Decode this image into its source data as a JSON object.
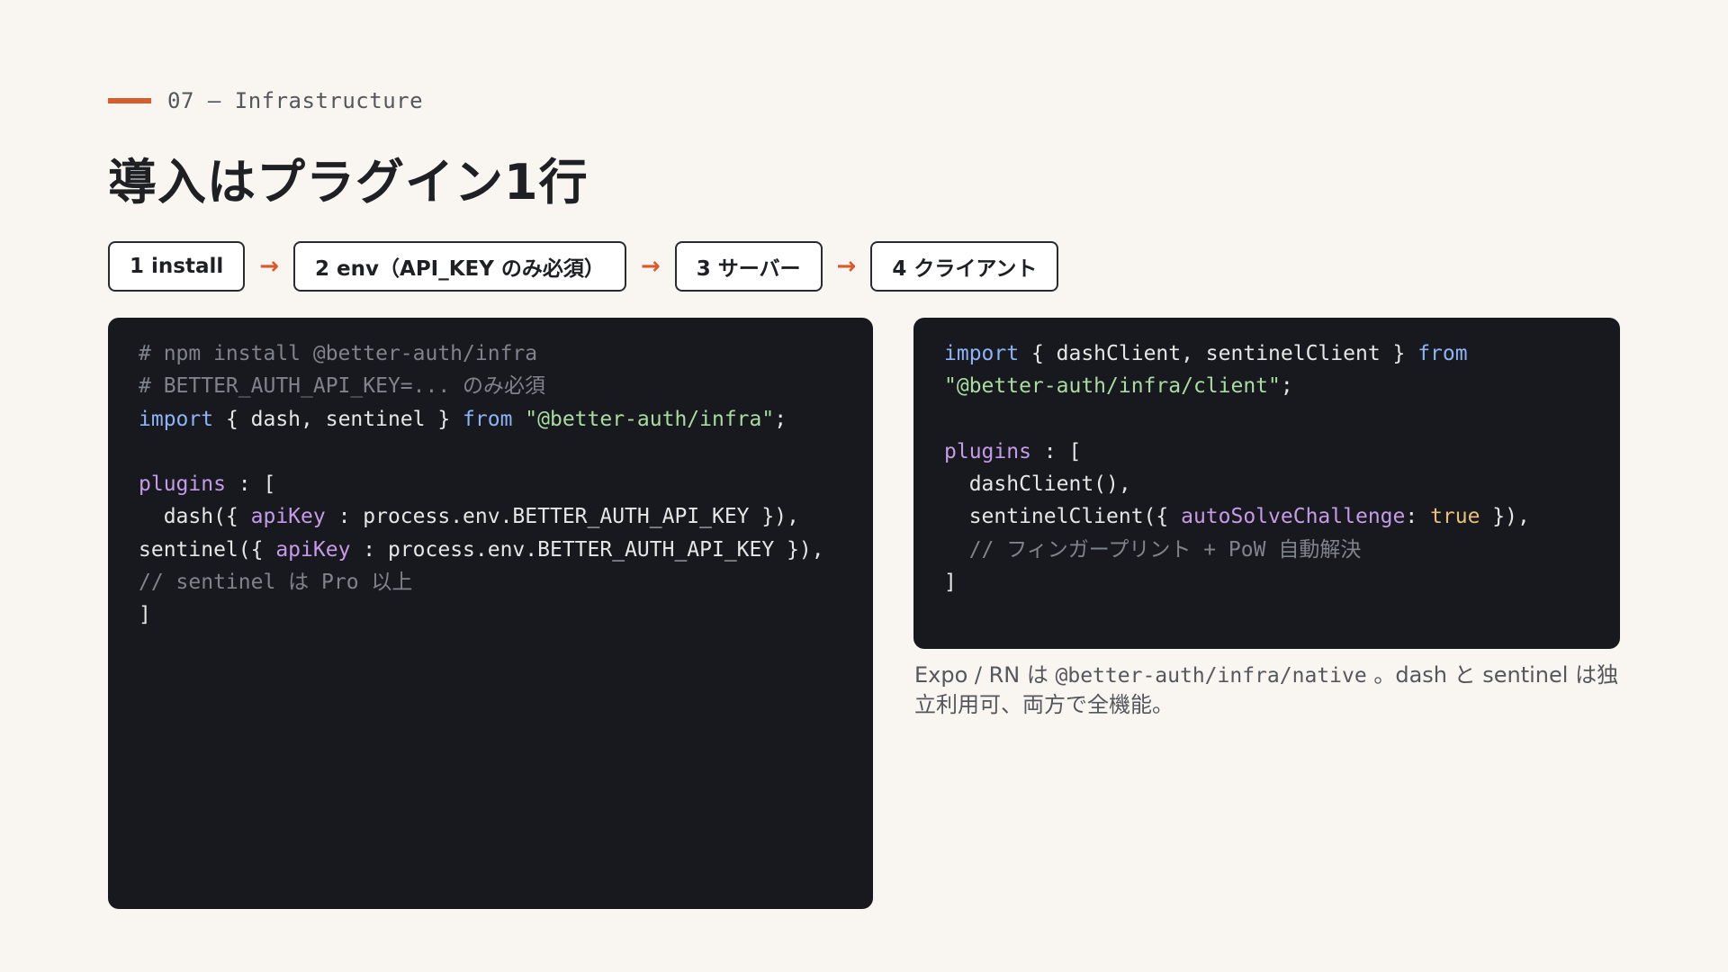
{
  "eyebrow": "07 — Infrastructure",
  "title": "導入はプラグイン1行",
  "steps": [
    {
      "label": "1 install"
    },
    {
      "label": "2 env（API_KEY のみ必須）"
    },
    {
      "label": "3 サーバー"
    },
    {
      "label": "4 クライアント"
    }
  ],
  "step_arrow": "→",
  "code_left": {
    "comment1": "# npm install @better-auth/infra",
    "comment2": "# BETTER_AUTH_API_KEY=... のみ必須",
    "import_kw": "import",
    "import_names": " { dash, sentinel } ",
    "from_kw": "from",
    "import_path": " \"@better-auth/infra\"",
    "semicolon": ";",
    "plugins_kw": "plugins",
    "plugins_open": " : [",
    "dash_call_start": "  dash({ ",
    "apikey1": "apiKey",
    "dash_call_end": " : process.env.BETTER_AUTH_API_KEY }),",
    "sentinel_call_start": "sentinel({ ",
    "apikey2": "apiKey",
    "sentinel_call_end": " : process.env.BETTER_AUTH_API_KEY }),",
    "comment3": "// sentinel は Pro 以上",
    "close_bracket": "]"
  },
  "code_right": {
    "import_kw": "import",
    "import_names": " { dashClient, sentinelClient } ",
    "from_kw": "from",
    "import_path": "\"@better-auth/infra/client\"",
    "semicolon": ";",
    "plugins_kw": "plugins",
    "plugins_open": " : [",
    "dash_client": "  dashClient(),",
    "sentinel_start": "  sentinelClient({ ",
    "auto_solve": "autoSolveChallenge",
    "colon": ": ",
    "true_val": "true",
    "sentinel_end": " }),",
    "comment": "  // フィンガープリント + PoW 自動解決",
    "close_bracket": "]"
  },
  "note": {
    "prefix": "Expo / RN は ",
    "code": "@better-auth/infra/native",
    "suffix": " 。dash と sentinel は独立利用可、両方で全機能。"
  },
  "colors": {
    "accent": "#d95a2b",
    "code_bg": "#18191e",
    "page_bg": "#f9f6f2",
    "keyword": "#8cb4f5",
    "string": "#a8dca0",
    "property": "#c59be8",
    "comment": "#7f838c",
    "boolean": "#e8c07a"
  }
}
